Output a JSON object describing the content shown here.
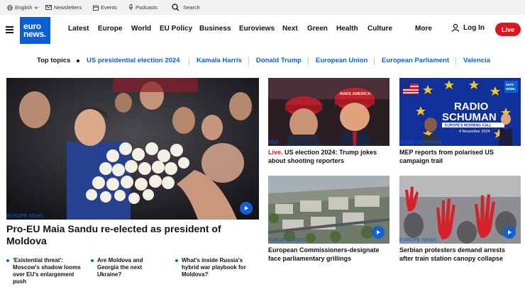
{
  "utility_bar": {
    "language": "English",
    "newsletters": "Newsletters",
    "events": "Events",
    "podcasts": "Podcasts",
    "search": "Search"
  },
  "nav": {
    "logo_line1": "euro",
    "logo_line2": "news.",
    "items": [
      "Latest",
      "Europe",
      "World",
      "EU Policy",
      "Business",
      "Euroviews",
      "Next",
      "Green",
      "Health",
      "Culture"
    ],
    "more": "More",
    "login": "Log In",
    "live": "Live"
  },
  "topics": {
    "label": "Top topics",
    "items": [
      "US presidential election 2024",
      "Kamala Harris",
      "Donald Trump",
      "European Union",
      "European Parliament",
      "Valencia"
    ]
  },
  "hero": {
    "kicker": "EUROPE NEWS",
    "headline": "Pro-EU Maia Sandu re-elected as president of Moldova"
  },
  "related": [
    "'Existential threat': Moscow's shadow looms over EU's enlargement push",
    "Are Moldova and Georgia the next Ukraine?",
    "What's inside Russia's hybrid war playbook for Moldova?"
  ],
  "cards": [
    {
      "kicker": "USA",
      "live_prefix": "Live.",
      "headline": "US election 2024: Trump jokes about shooting reporters"
    },
    {
      "kicker": "RADIO SCHUMAN",
      "headline": "MEP reports from polarised US campaign trail"
    },
    {
      "kicker": "EUROPE NEWS",
      "headline": "European Commissioners-designate face parliamentary grillings"
    },
    {
      "kicker": "EUROPE NEWS",
      "headline": "Serbian protesters demand arrests after train station canopy collapse"
    }
  ],
  "radio_art": {
    "title1": "RADIO",
    "title2": "SCHUMAN",
    "subtitle": "EUROPE'S MORNING CALL",
    "date": "4 November 2024",
    "logo_line1": "euro",
    "logo_line2": "news."
  },
  "colors": {
    "accent": "#0a5fd6",
    "live": "#e3121b",
    "utility_bg": "#f0f1f2"
  }
}
